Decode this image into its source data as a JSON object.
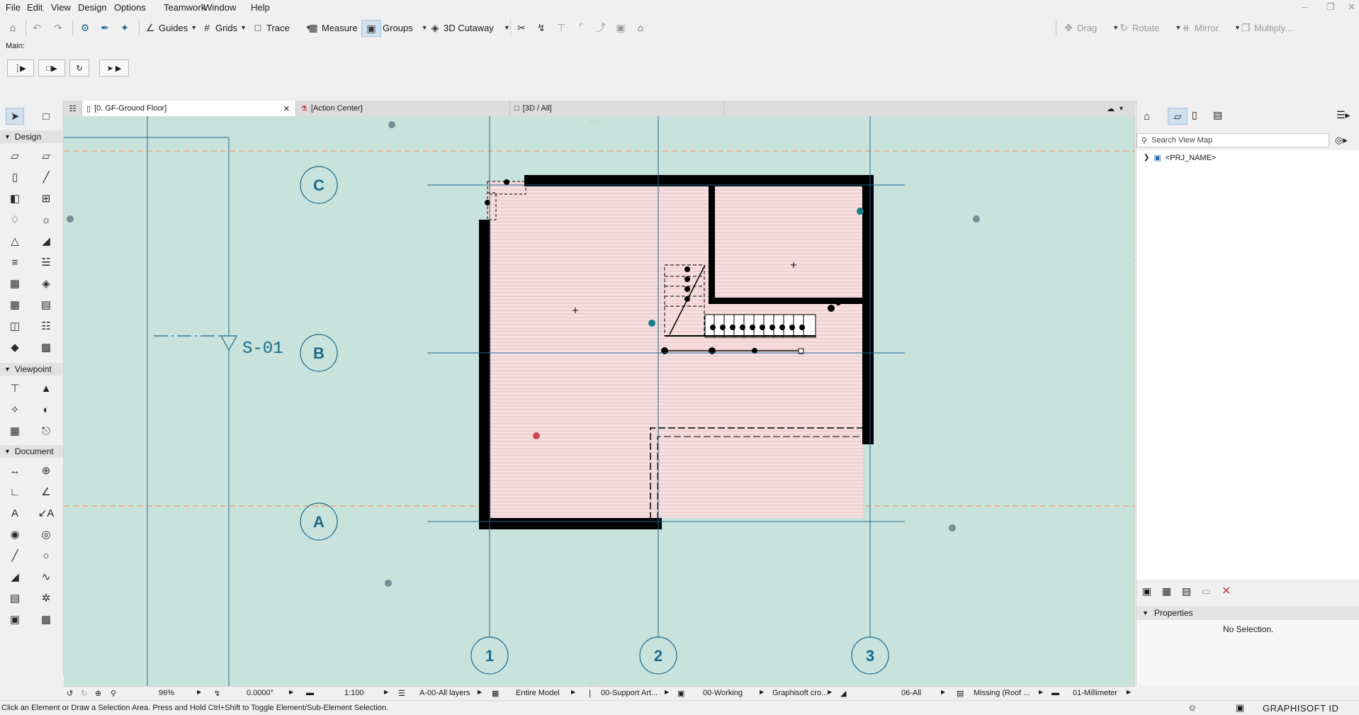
{
  "menu": [
    "File",
    "Edit",
    "View",
    "Design",
    "Options",
    "Teamwork",
    "Window",
    "Help"
  ],
  "toolbar": {
    "guides": "Guides",
    "grids": "Grids",
    "trace": "Trace",
    "measure": "Measure",
    "groups": "Groups",
    "cutaway": "3D Cutaway",
    "drag": "Drag",
    "rotate": "Rotate",
    "mirror": "Mirror",
    "multiply": "Multiply..."
  },
  "infobox": {
    "label": "Main:"
  },
  "tabs": [
    {
      "label": "[0. GF-Ground Floor]",
      "active": true
    },
    {
      "label": "[Action Center]",
      "active": false
    },
    {
      "label": "[3D / All]",
      "active": false
    }
  ],
  "toolbox": {
    "sections": [
      "Design",
      "Viewpoint",
      "Document"
    ]
  },
  "canvas": {
    "grid_rows": [
      "C",
      "B",
      "A"
    ],
    "grid_cols": [
      "1",
      "2",
      "3"
    ],
    "section_marker": "S-01",
    "background_color": "#c8e2dc",
    "grid_color": "#1b6a8a"
  },
  "statusbar": {
    "zoom": "96%",
    "angle": "0.0000°",
    "scale": "1:100",
    "layers": "A-00-All layers",
    "model": "Entire Model",
    "support": "00-Support Art...",
    "working": "00-Working",
    "graphisoft": "Graphisoft cro...",
    "renovation": "06-All",
    "missing": "Missing (Roof ...",
    "dimension": "01-Millimeter"
  },
  "hint": "Click an Element or Draw a Selection Area. Press and Hold Ctrl+Shift to Toggle Element/Sub-Element Selection.",
  "navigator": {
    "search_placeholder": "Search View Map",
    "tree_root": "<PRJ_NAME>",
    "properties_title": "Properties",
    "no_selection": "No Selection."
  },
  "brand": "GRAPHISOFT ID"
}
